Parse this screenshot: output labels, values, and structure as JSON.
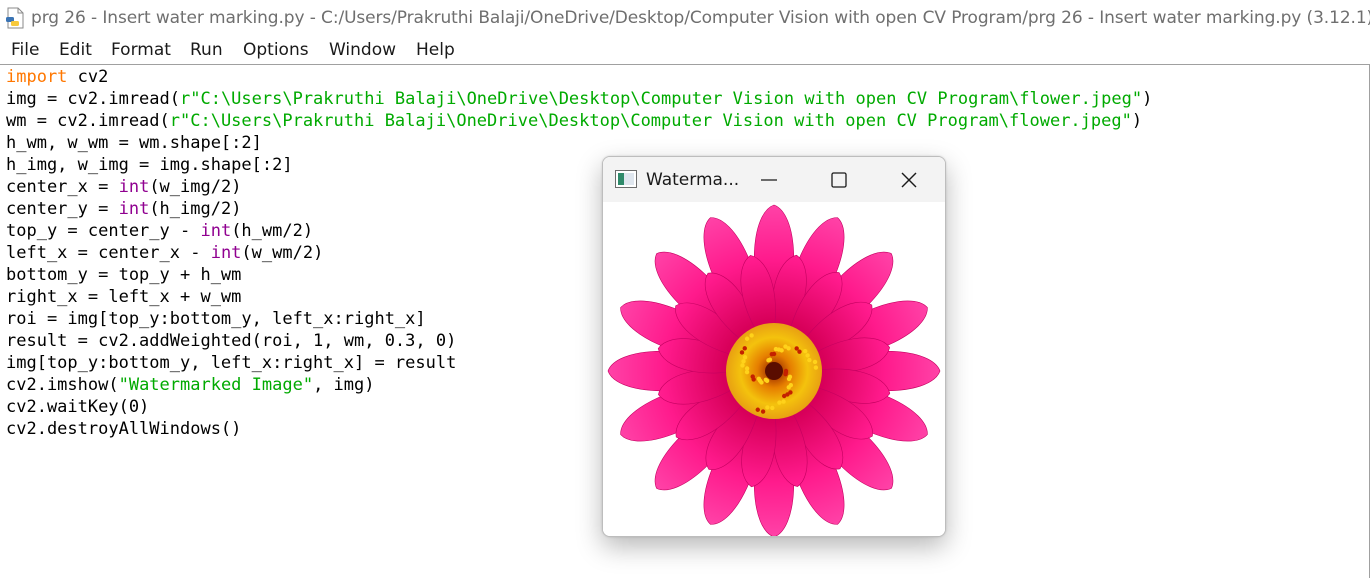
{
  "window": {
    "title": "prg 26 -  Insert water marking.py - C:/Users/Prakruthi Balaji/OneDrive/Desktop/Computer Vision with open CV Program/prg 26 -  Insert water marking.py (3.12.1)",
    "app_icon": "python-file-icon"
  },
  "menubar": {
    "items": [
      {
        "label": "File"
      },
      {
        "label": "Edit"
      },
      {
        "label": "Format"
      },
      {
        "label": "Run"
      },
      {
        "label": "Options"
      },
      {
        "label": "Window"
      },
      {
        "label": "Help"
      }
    ]
  },
  "editor": {
    "lines": [
      [
        {
          "t": "import",
          "c": "kw"
        },
        {
          "t": " cv2"
        }
      ],
      [
        {
          "t": "img = cv2.imread("
        },
        {
          "t": "r\"C:\\Users\\Prakruthi Balaji\\OneDrive\\Desktop\\Computer Vision with open CV Program\\flower.jpeg\"",
          "c": "st"
        },
        {
          "t": ")"
        }
      ],
      [
        {
          "t": "wm = cv2.imread("
        },
        {
          "t": "r\"C:\\Users\\Prakruthi Balaji\\OneDrive\\Desktop\\Computer Vision with open CV Program\\flower.jpeg\"",
          "c": "st"
        },
        {
          "t": ")"
        }
      ],
      [
        {
          "t": "h_wm, w_wm = wm.shape[:2]"
        }
      ],
      [
        {
          "t": "h_img, w_img = img.shape[:2]"
        }
      ],
      [
        {
          "t": "center_x = "
        },
        {
          "t": "int",
          "c": "bi"
        },
        {
          "t": "(w_img/2)"
        }
      ],
      [
        {
          "t": "center_y = "
        },
        {
          "t": "int",
          "c": "bi"
        },
        {
          "t": "(h_img/2)"
        }
      ],
      [
        {
          "t": "top_y = center_y - "
        },
        {
          "t": "int",
          "c": "bi"
        },
        {
          "t": "(h_wm/2)"
        }
      ],
      [
        {
          "t": "left_x = center_x - "
        },
        {
          "t": "int",
          "c": "bi"
        },
        {
          "t": "(w_wm/2)"
        }
      ],
      [
        {
          "t": "bottom_y = top_y + h_wm"
        }
      ],
      [
        {
          "t": "right_x = left_x + w_wm"
        }
      ],
      [
        {
          "t": "roi = img[top_y:bottom_y, left_x:right_x]"
        }
      ],
      [
        {
          "t": "result = cv2.addWeighted(roi, 1, wm, 0.3, 0)"
        }
      ],
      [
        {
          "t": "img[top_y:bottom_y, left_x:right_x] = result"
        }
      ],
      [
        {
          "t": "cv2.imshow("
        },
        {
          "t": "\"Watermarked Image\"",
          "c": "st"
        },
        {
          "t": ", img)"
        }
      ],
      [
        {
          "t": "cv2.waitKey(0)"
        }
      ],
      [
        {
          "t": "cv2.destroyAllWindows()"
        }
      ]
    ]
  },
  "popup": {
    "title": "Waterma...",
    "icon": "opencv-window-icon",
    "controls": [
      "minimize-icon",
      "maximize-icon",
      "close-icon"
    ],
    "image": "pink-flower-image"
  },
  "colors": {
    "keyword": "#ff7700",
    "builtin": "#900090",
    "string": "#00aa00",
    "flower_petal": "#ff1a8c",
    "flower_center": "#f4c20d"
  }
}
